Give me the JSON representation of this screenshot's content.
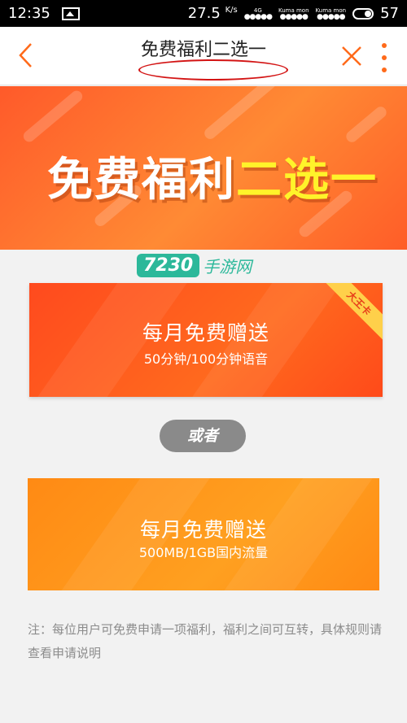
{
  "status_bar": {
    "time": "12:35",
    "net_speed": "27.5",
    "net_unit": "K/s",
    "network_type": "4G",
    "carrier_1": "Kuma mon",
    "carrier_2": "Kuma mon",
    "battery": "57"
  },
  "header": {
    "title": "免费福利二选一",
    "back_icon": "chevron-left-icon",
    "close_icon": "close-icon",
    "more_icon": "more-vertical-icon",
    "accent_color": "#ff6a1a",
    "annotation_color": "#d31414"
  },
  "banner": {
    "title_white": "免费福利",
    "title_yellow": "二选一"
  },
  "watermark": {
    "number": "7230",
    "text": "手游网"
  },
  "options": [
    {
      "title": "每月免费赠送",
      "subtitle": "50分钟/100分钟语音",
      "tag": "大王卡",
      "color": "#ff4a1e"
    },
    {
      "title": "每月免费赠送",
      "subtitle": "500MB/1GB国内流量",
      "color": "#ff8a14"
    }
  ],
  "or_label": "或者",
  "note": "注：每位用户可免费申请一项福利，福利之间可互转，具体规则请查看申请说明"
}
